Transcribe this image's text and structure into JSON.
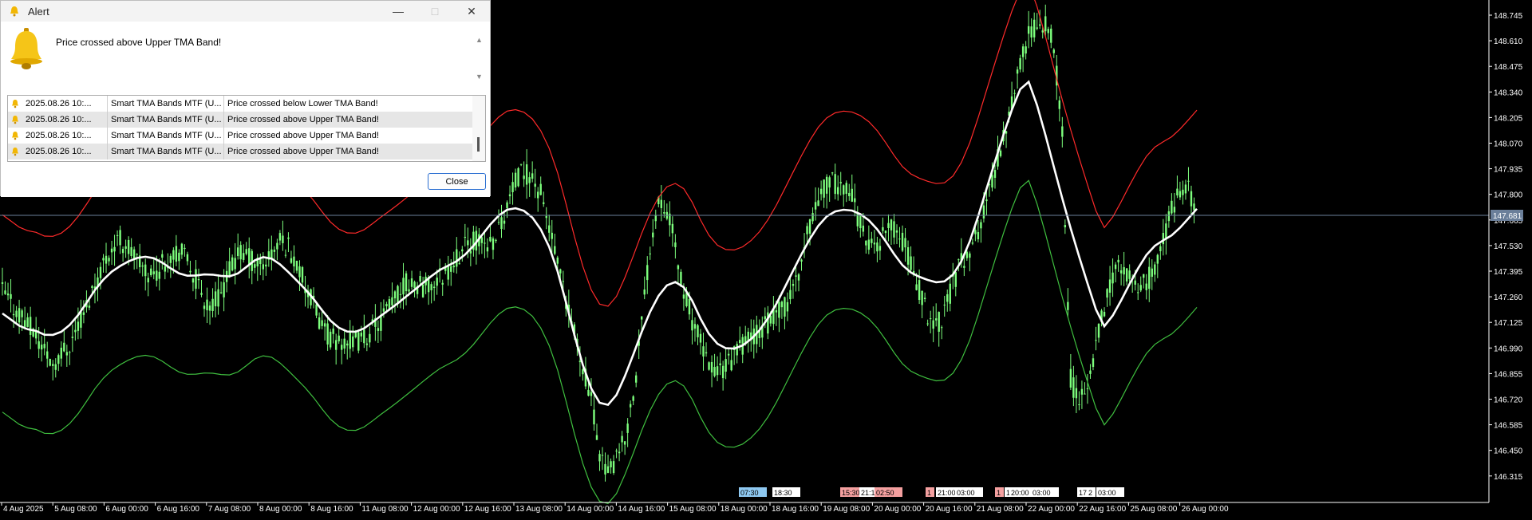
{
  "alert": {
    "title": "Alert",
    "message": "Price crossed above Upper TMA Band!",
    "close_label": "Close",
    "history": [
      {
        "time": "2025.08.26 10:...",
        "source": "Smart TMA Bands MTF (U...",
        "message": "Price crossed below Lower TMA Band!"
      },
      {
        "time": "2025.08.26 10:...",
        "source": "Smart TMA Bands MTF (U...",
        "message": "Price crossed above Upper TMA Band!"
      },
      {
        "time": "2025.08.26 10:...",
        "source": "Smart TMA Bands MTF (U...",
        "message": "Price crossed above Upper TMA Band!"
      },
      {
        "time": "2025.08.26 10:...",
        "source": "Smart TMA Bands MTF (U...",
        "message": "Price crossed above Upper TMA Band!"
      }
    ]
  },
  "chart": {
    "current_price": "147.681",
    "price_axis": [
      "148.745",
      "148.610",
      "148.475",
      "148.340",
      "148.205",
      "148.070",
      "147.935",
      "147.800",
      "147.665",
      "147.530",
      "147.395",
      "147.260",
      "147.125",
      "146.990",
      "146.855",
      "146.720",
      "146.585",
      "146.450",
      "146.315"
    ],
    "time_axis": [
      "4 Aug 2025",
      "5 Aug 08:00",
      "6 Aug 00:00",
      "6 Aug 16:00",
      "7 Aug 08:00",
      "8 Aug 00:00",
      "8 Aug 16:00",
      "11 Aug 08:00",
      "12 Aug 00:00",
      "12 Aug 16:00",
      "13 Aug 08:00",
      "14 Aug 00:00",
      "14 Aug 16:00",
      "15 Aug 08:00",
      "18 Aug 00:00",
      "18 Aug 16:00",
      "19 Aug 08:00",
      "20 Aug 00:00",
      "20 Aug 16:00",
      "21 Aug 08:00",
      "22 Aug 00:00",
      "22 Aug 16:00",
      "25 Aug 08:00",
      "26 Aug 00:00"
    ],
    "session_markers": [
      {
        "text": "07:30",
        "color": "#8ec8f0"
      },
      {
        "text": "18:30",
        "color": "#ffffff"
      },
      {
        "text": "15:30",
        "color": "#f4a0a0"
      },
      {
        "text": "21:1",
        "color": "#ffffff"
      },
      {
        "text": "02:50",
        "color": "#f4a0a0"
      },
      {
        "text": "1",
        "color": "#f4a0a0"
      },
      {
        "text": "21:00",
        "color": "#ffffff"
      },
      {
        "text": "03:00",
        "color": "#ffffff"
      },
      {
        "text": "1",
        "color": "#f4a0a0"
      },
      {
        "text": "1",
        "color": "#ffffff"
      },
      {
        "text": "20:00",
        "color": "#ffffff"
      },
      {
        "text": "03:00",
        "color": "#ffffff"
      },
      {
        "text": "17",
        "color": "#ffffff"
      },
      {
        "text": "2",
        "color": "#ffffff"
      },
      {
        "text": "03:00",
        "color": "#ffffff"
      }
    ],
    "colors": {
      "candles": "#7dff7d",
      "upper_band": "#ff2a2a",
      "lower_band": "#3fbf3f",
      "middle_band": "#ffffff",
      "background": "#000000",
      "price_line": "#6b7f9a"
    },
    "series": {
      "close": [
        147.29,
        147.22,
        147.18,
        147.12,
        147.05,
        146.98,
        146.91,
        146.96,
        147.01,
        147.11,
        147.21,
        147.33,
        147.44,
        147.52,
        147.56,
        147.52,
        147.45,
        147.39,
        147.38,
        147.43,
        147.49,
        147.5,
        147.45,
        147.35,
        147.25,
        147.21,
        147.28,
        147.39,
        147.48,
        147.48,
        147.44,
        147.43,
        147.49,
        147.55,
        147.53,
        147.43,
        147.32,
        147.21,
        147.11,
        147.04,
        147.02,
        147.02,
        147.02,
        147.04,
        147.09,
        147.14,
        147.2,
        147.27,
        147.33,
        147.33,
        147.31,
        147.32,
        147.36,
        147.41,
        147.47,
        147.52,
        147.56,
        147.54,
        147.54,
        147.62,
        147.74,
        147.86,
        147.92,
        147.89,
        147.8,
        147.63,
        147.42,
        147.22,
        147.06,
        146.91,
        146.7,
        146.45,
        146.33,
        146.39,
        146.51,
        146.74,
        147.12,
        147.53,
        147.8,
        147.73,
        147.52,
        147.29,
        147.14,
        147.01,
        146.9,
        146.87,
        146.89,
        146.95,
        147.01,
        147.05,
        147.08,
        147.12,
        147.16,
        147.2,
        147.29,
        147.45,
        147.64,
        147.79,
        147.85,
        147.86,
        147.85,
        147.78,
        147.64,
        147.53,
        147.53,
        147.6,
        147.62,
        147.56,
        147.43,
        147.29,
        147.17,
        147.11,
        147.18,
        147.33,
        147.45,
        147.51,
        147.6,
        147.75,
        147.93,
        148.11,
        148.3,
        148.48,
        148.63,
        148.71,
        148.7,
        148.58,
        148.1,
        146.82,
        146.7,
        146.78,
        146.99,
        147.2,
        147.38,
        147.42,
        147.35,
        147.3,
        147.33,
        147.42,
        147.56,
        147.72,
        147.84,
        147.82,
        147.68
      ]
    }
  }
}
